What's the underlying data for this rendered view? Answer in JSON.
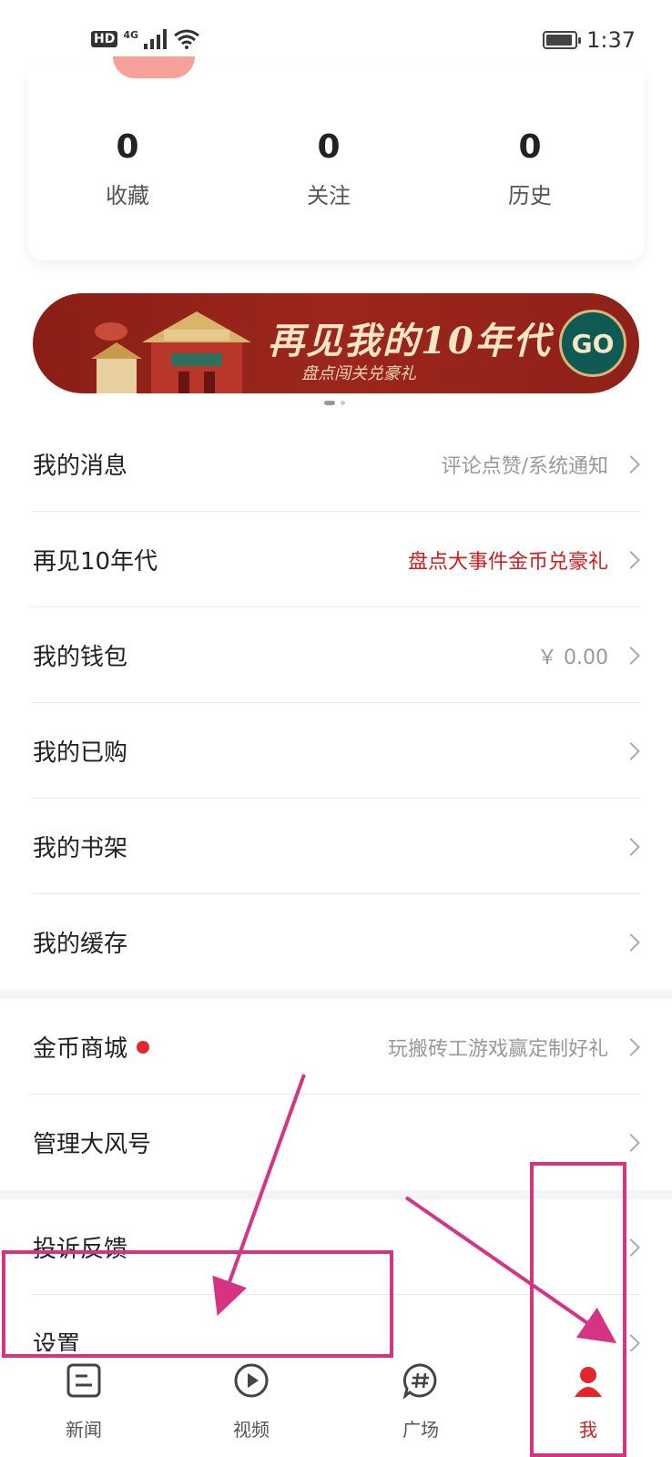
{
  "status_bar": {
    "hd": "HD",
    "network": "4G",
    "time": "1:37"
  },
  "stats": [
    {
      "value": "0",
      "label": "收藏"
    },
    {
      "value": "0",
      "label": "关注"
    },
    {
      "value": "0",
      "label": "历史"
    }
  ],
  "banner": {
    "title": "再见我的10年代",
    "subtitle": "盘点闯关兑豪礼",
    "button": "GO"
  },
  "menu": {
    "messages": {
      "label": "我的消息",
      "sub": "评论点赞/系统通知"
    },
    "decade": {
      "label": "再见10年代",
      "sub": "盘点大事件金币兑豪礼"
    },
    "wallet": {
      "label": "我的钱包",
      "sub": "￥ 0.00"
    },
    "purchased": {
      "label": "我的已购"
    },
    "bookshelf": {
      "label": "我的书架"
    },
    "cache": {
      "label": "我的缓存"
    },
    "coin_mall": {
      "label": "金币商城",
      "sub": "玩搬砖工游戏赢定制好礼"
    },
    "manage": {
      "label": "管理大风号"
    },
    "feedback": {
      "label": "投诉反馈"
    },
    "settings": {
      "label": "设置"
    }
  },
  "tabs": [
    {
      "label": "新闻",
      "icon": "news-icon"
    },
    {
      "label": "视频",
      "icon": "play-icon"
    },
    {
      "label": "广场",
      "icon": "hashtag-chat-icon"
    },
    {
      "label": "我",
      "icon": "profile-icon"
    }
  ],
  "colors": {
    "accent_red": "#d21d1d",
    "annotation": "#d63385"
  }
}
